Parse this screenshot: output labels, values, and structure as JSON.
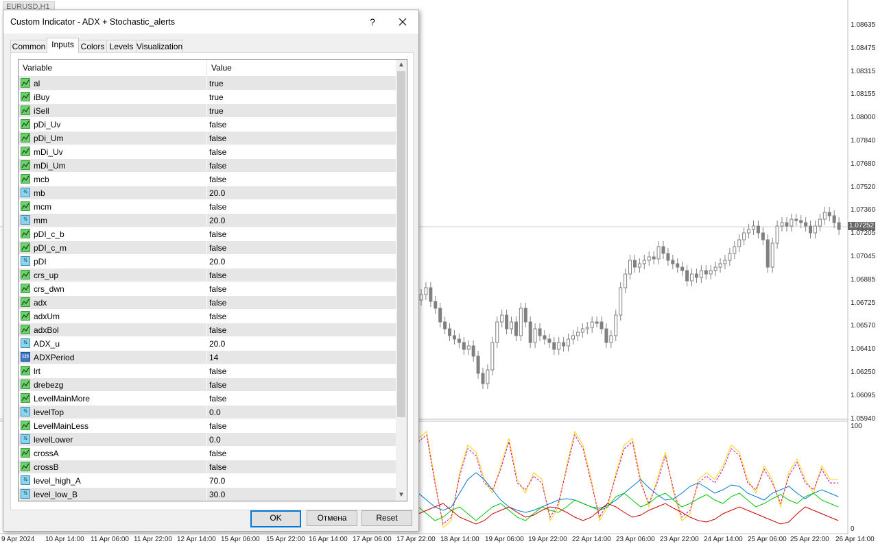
{
  "chart": {
    "symbol_title": "EURUSD,H1",
    "current_price": "1.07252",
    "price_scale": [
      "1.08635",
      "1.08475",
      "1.08315",
      "1.08155",
      "1.08000",
      "1.07840",
      "1.07680",
      "1.07520",
      "1.07360",
      "1.07205",
      "1.07045",
      "1.06885",
      "1.06725",
      "1.06570",
      "1.06410",
      "1.06250",
      "1.06095",
      "1.05940"
    ],
    "indicator_scale": [
      "100",
      "0"
    ],
    "time_axis": [
      "9 Apr 2024",
      "10 Apr 14:00",
      "11 Apr 06:00",
      "11 Apr 22:00",
      "12 Apr 14:00",
      "15 Apr 06:00",
      "15 Apr 22:00",
      "16 Apr 14:00",
      "17 Apr 06:00",
      "17 Apr 22:00",
      "18 Apr 14:00",
      "19 Apr 06:00",
      "19 Apr 22:00",
      "22 Apr 14:00",
      "23 Apr 06:00",
      "23 Apr 22:00",
      "24 Apr 14:00",
      "25 Apr 06:00",
      "25 Apr 22:00",
      "26 Apr 14:00"
    ],
    "colors": {
      "adx": "#0078d7",
      "plus_di": "#00c800",
      "minus_di": "#c80000",
      "stoch_main": "#ffd700",
      "stoch_signal": "#c800c8",
      "candle": "#808080"
    }
  },
  "dialog": {
    "title": "Custom Indicator - ADX + Stochastic_alerts",
    "help_label": "?",
    "tabs": [
      "Common",
      "Inputs",
      "Colors",
      "Levels",
      "Visualization"
    ],
    "active_tab": "Inputs",
    "columns": {
      "variable": "Variable",
      "value": "Value"
    },
    "rows": [
      {
        "var": "al",
        "val": "true",
        "type": "bool"
      },
      {
        "var": "iBuy",
        "val": "true",
        "type": "bool"
      },
      {
        "var": "iSell",
        "val": "true",
        "type": "bool"
      },
      {
        "var": "pDi_Uv",
        "val": "false",
        "type": "bool"
      },
      {
        "var": "pDi_Um",
        "val": "false",
        "type": "bool"
      },
      {
        "var": "mDi_Uv",
        "val": "false",
        "type": "bool"
      },
      {
        "var": "mDi_Um",
        "val": "false",
        "type": "bool"
      },
      {
        "var": "mcb",
        "val": "false",
        "type": "bool"
      },
      {
        "var": "mb",
        "val": "20.0",
        "type": "num"
      },
      {
        "var": "mcm",
        "val": "false",
        "type": "bool"
      },
      {
        "var": "mm",
        "val": "20.0",
        "type": "num"
      },
      {
        "var": "pDI_c_b",
        "val": "false",
        "type": "bool"
      },
      {
        "var": "pDI_c_m",
        "val": "false",
        "type": "bool"
      },
      {
        "var": "pDI",
        "val": "20.0",
        "type": "num"
      },
      {
        "var": "crs_up",
        "val": "false",
        "type": "bool"
      },
      {
        "var": "crs_dwn",
        "val": "false",
        "type": "bool"
      },
      {
        "var": "adx",
        "val": "false",
        "type": "bool"
      },
      {
        "var": "adxUm",
        "val": "false",
        "type": "bool"
      },
      {
        "var": "adxBol",
        "val": "false",
        "type": "bool"
      },
      {
        "var": "ADX_u",
        "val": "20.0",
        "type": "num"
      },
      {
        "var": "ADXPeriod",
        "val": "14",
        "type": "int"
      },
      {
        "var": "lrt",
        "val": "false",
        "type": "bool"
      },
      {
        "var": "drebezg",
        "val": "false",
        "type": "bool"
      },
      {
        "var": "LevelMainMore",
        "val": "false",
        "type": "bool"
      },
      {
        "var": "levelTop",
        "val": "0.0",
        "type": "num"
      },
      {
        "var": "LevelMainLess",
        "val": "false",
        "type": "bool"
      },
      {
        "var": "levelLower",
        "val": "0.0",
        "type": "num"
      },
      {
        "var": "crossA",
        "val": "false",
        "type": "bool"
      },
      {
        "var": "crossB",
        "val": "false",
        "type": "bool"
      },
      {
        "var": "level_high_A",
        "val": "70.0",
        "type": "num"
      },
      {
        "var": "level_low_B",
        "val": "30.0",
        "type": "num"
      }
    ],
    "buttons": {
      "ok": "OK",
      "cancel": "Отмена",
      "reset": "Reset"
    }
  }
}
